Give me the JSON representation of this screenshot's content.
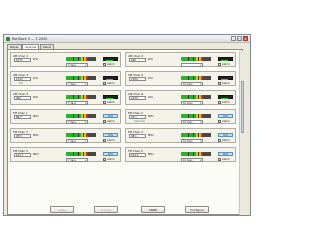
{
  "window": {
    "title": "RoHSock 5 — F-2000",
    "controls": [
      "_",
      "□",
      "×"
    ],
    "icon": "app-icon"
  },
  "tabs": [
    "Player",
    "Sources",
    "About"
  ],
  "active_tab": "Sources",
  "cards": [
    {
      "title": "AM Chan 1",
      "freq": "1575",
      "unit": "kHz",
      "sub": "",
      "select": "7 days",
      "alarm": "Alarm",
      "badge": ""
    },
    {
      "title": "AM Chan 2",
      "freq": "690",
      "unit": "kHz",
      "sub": "",
      "select": "",
      "alarm": "Alarm",
      "badge": ""
    },
    {
      "title": "AM Chan 3",
      "freq": "1230",
      "unit": "kHz",
      "sub": "2%",
      "select": "7 days",
      "alarm": "Alarm",
      "badge": ""
    },
    {
      "title": "AM Chan 4",
      "freq": "1080",
      "unit": "kHz",
      "sub": "",
      "select": "10 days",
      "alarm": "Alarm",
      "badge": ""
    },
    {
      "title": "AM Chan 5",
      "freq": "994",
      "unit": "kHz",
      "sub": "",
      "select": "7 days",
      "alarm": "Alarm",
      "badge": ""
    },
    {
      "title": "AM Chan 6",
      "freq": "1430",
      "unit": "kHz",
      "sub": "",
      "select": "10 days",
      "alarm": "Alarm",
      "badge": ""
    },
    {
      "title": "FM Chan 1",
      "freq": "88.7",
      "unit": "MHz",
      "sub": "",
      "select": "7 days",
      "alarm": "Alarm",
      "badge": "RDS"
    },
    {
      "title": "FM Chan 2",
      "freq": "93.1",
      "unit": "MHz",
      "sub": "Channel",
      "select": "10 days",
      "alarm": "Alarm",
      "badge": "RDS"
    },
    {
      "title": "FM Chan 3",
      "freq": "95.5",
      "unit": "MHz",
      "sub": "",
      "select": "7 days",
      "alarm": "Alarm",
      "badge": "RDS"
    },
    {
      "title": "FM Chan 4",
      "freq": "98.1",
      "unit": "MHz",
      "sub": "",
      "select": "10 days",
      "alarm": "Alarm",
      "badge": "RDS"
    },
    {
      "title": "FM Chan 5",
      "freq": "101.7",
      "unit": "MHz",
      "sub": "",
      "select": "7 days",
      "alarm": "Alarm",
      "badge": "RDS"
    },
    {
      "title": "FM Chan 6",
      "freq": "104.3",
      "unit": "MHz",
      "sub": "",
      "select": "10 days",
      "alarm": "Alarm",
      "badge": "RDS"
    }
  ],
  "footer": {
    "apply": "Apply",
    "cancel": "Cancel",
    "snmp": "SNMP",
    "configure": "Configure"
  },
  "colors": {
    "meter_green": "#27b427",
    "meter_yellow": "#d8c618",
    "meter_red": "#c82c2c",
    "badge_blue": "#bfe1f3"
  }
}
